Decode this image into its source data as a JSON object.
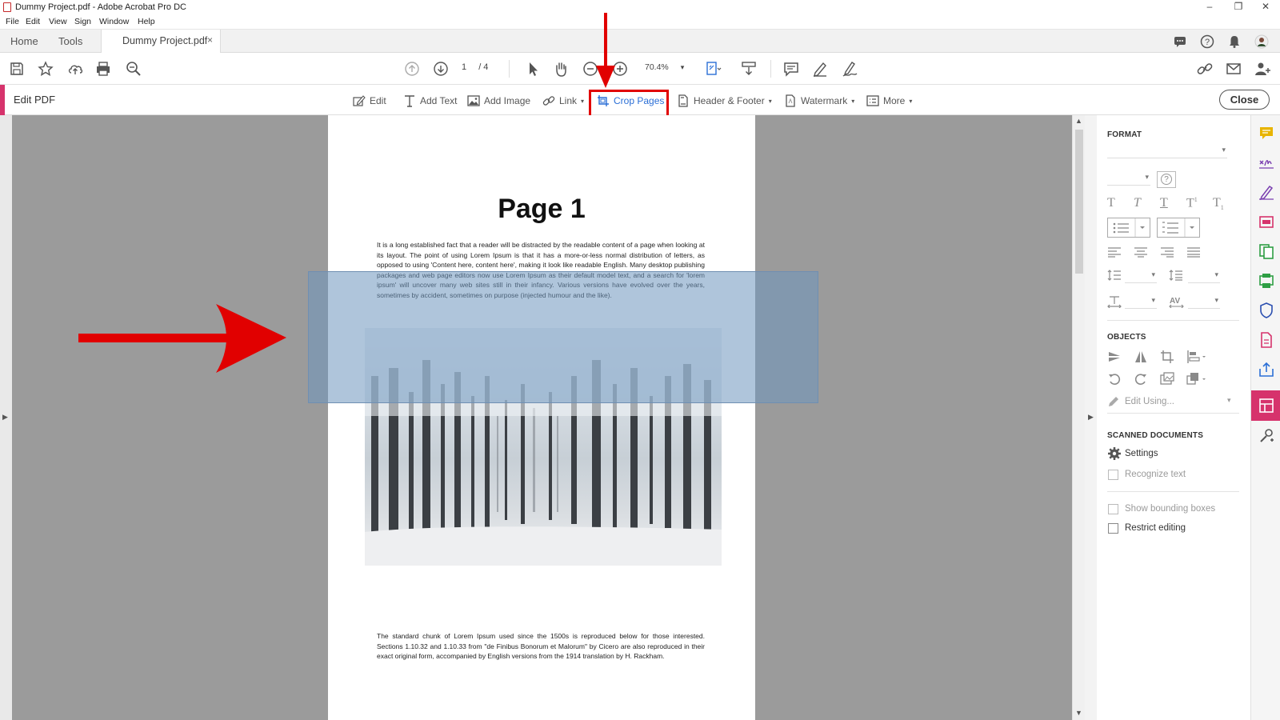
{
  "window": {
    "title": "Dummy Project.pdf - Adobe Acrobat Pro DC",
    "controls": {
      "minimize": "–",
      "restore": "❐",
      "close": "✕"
    }
  },
  "menu": [
    "File",
    "Edit",
    "View",
    "Sign",
    "Window",
    "Help"
  ],
  "tabs": {
    "home": "Home",
    "tools": "Tools",
    "document": "Dummy Project.pdf",
    "close_glyph": "×"
  },
  "toolbar": {
    "page_current": "1",
    "page_total": "/ 4",
    "zoom": "70.4%"
  },
  "edit_bar": {
    "heading": "Edit PDF",
    "tools": {
      "edit": "Edit",
      "add_text": "Add Text",
      "add_image": "Add Image",
      "link": "Link",
      "crop_pages": "Crop Pages",
      "header_footer": "Header & Footer",
      "watermark": "Watermark",
      "more": "More"
    },
    "close": "Close"
  },
  "document": {
    "page_title": "Page 1",
    "paragraph1": "It is a long established fact that a reader will be distracted by the readable content of a page when looking at its layout. The point of using Lorem Ipsum is that it has a more-or-less normal distribution of letters, as opposed to using 'Content here, content here', making it look like readable English. Many desktop publishing packages and web page editors now use Lorem Ipsum as their default model text, and a search for 'lorem ipsum' will uncover many web sites still in their infancy. Various versions have evolved over the years, sometimes by accident, sometimes on purpose (injected humour and the like).",
    "paragraph2": "The standard chunk of Lorem Ipsum used since the 1500s is reproduced below for those interested. Sections 1.10.32 and 1.10.33 from \"de Finibus Bonorum et Malorum\" by Cicero are also reproduced in their exact original form, accompanied by English versions from the 1914 translation by H. Rackham."
  },
  "right_panel": {
    "format_heading": "FORMAT",
    "help_glyph": "?",
    "objects_heading": "OBJECTS",
    "edit_using": "Edit Using...",
    "scanned_heading": "SCANNED DOCUMENTS",
    "settings": "Settings",
    "recognize_text": "Recognize text",
    "show_bounding_boxes": "Show bounding boxes",
    "restrict_editing": "Restrict editing"
  },
  "colors": {
    "accent": "#d6336c",
    "annotation_red": "#e10000",
    "active_blue": "#2b6fd6"
  }
}
